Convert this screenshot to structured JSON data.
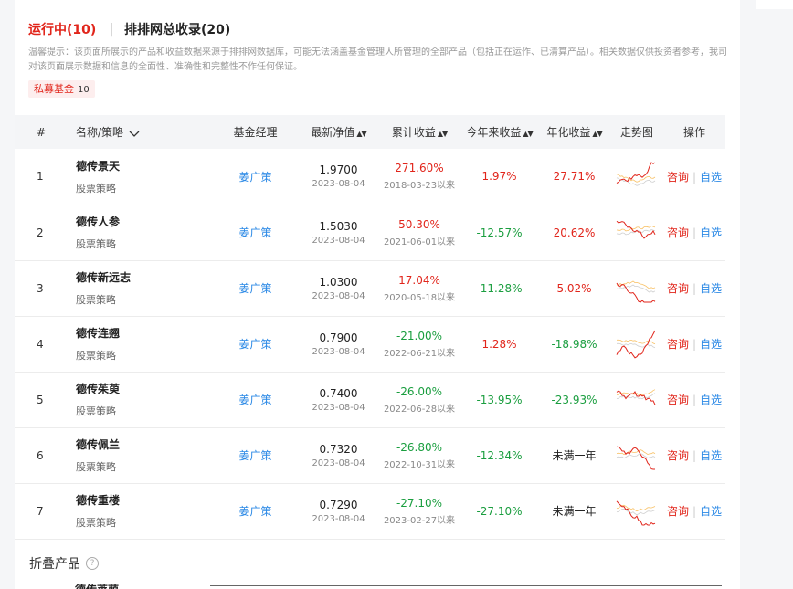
{
  "tabs": {
    "running": "运行中(10)",
    "separator": "|",
    "recorded": "排排网总收录(20)"
  },
  "notice": "温馨提示：该页面所展示的产品和收益数据来源于排排网数据库，可能无法涵盖基金管理人所管理的全部产品（包括正在运作、已清算产品）。相关数据仅供投资者参考，我司对该页面展示数据和信息的全面性、准确性和完整性不作任何保证。",
  "tag": {
    "label": "私募基金",
    "count": "10"
  },
  "table": {
    "headers": {
      "index": "#",
      "name": "名称/策略",
      "manager": "基金经理",
      "nav": "最新净值",
      "cum": "累计收益",
      "ytd": "今年来收益",
      "annual": "年化收益",
      "trend": "走势图",
      "ops": "操作"
    },
    "rows": [
      {
        "idx": "1",
        "name": "德传景天",
        "strategy": "股票策略",
        "manager": "姜广策",
        "nav": "1.9700",
        "nav_date": "2023-08-04",
        "cum": "271.60%",
        "cum_since": "2018-03-23以来",
        "ytd": "1.97%",
        "annual": "27.71%",
        "consult": "咨询",
        "fav": "自选"
      },
      {
        "idx": "2",
        "name": "德传人参",
        "strategy": "股票策略",
        "manager": "姜广策",
        "nav": "1.5030",
        "nav_date": "2023-08-04",
        "cum": "50.30%",
        "cum_since": "2021-06-01以来",
        "ytd": "-12.57%",
        "annual": "20.62%",
        "consult": "咨询",
        "fav": "自选"
      },
      {
        "idx": "3",
        "name": "德传新远志",
        "strategy": "股票策略",
        "manager": "姜广策",
        "nav": "1.0300",
        "nav_date": "2023-08-04",
        "cum": "17.04%",
        "cum_since": "2020-05-18以来",
        "ytd": "-11.28%",
        "annual": "5.02%",
        "consult": "咨询",
        "fav": "自选"
      },
      {
        "idx": "4",
        "name": "德传连翘",
        "strategy": "股票策略",
        "manager": "姜广策",
        "nav": "0.7900",
        "nav_date": "2023-08-04",
        "cum": "-21.00%",
        "cum_since": "2022-06-21以来",
        "ytd": "1.28%",
        "annual": "-18.98%",
        "consult": "咨询",
        "fav": "自选"
      },
      {
        "idx": "5",
        "name": "德传茱萸",
        "strategy": "股票策略",
        "manager": "姜广策",
        "nav": "0.7400",
        "nav_date": "2023-08-04",
        "cum": "-26.00%",
        "cum_since": "2022-06-28以来",
        "ytd": "-13.95%",
        "annual": "-23.93%",
        "consult": "咨询",
        "fav": "自选"
      },
      {
        "idx": "6",
        "name": "德传佩兰",
        "strategy": "股票策略",
        "manager": "姜广策",
        "nav": "0.7320",
        "nav_date": "2023-08-04",
        "cum": "-26.80%",
        "cum_since": "2022-10-31以来",
        "ytd": "-12.34%",
        "annual": "未满一年",
        "consult": "咨询",
        "fav": "自选"
      },
      {
        "idx": "7",
        "name": "德传重楼",
        "strategy": "股票策略",
        "manager": "姜广策",
        "nav": "0.7290",
        "nav_date": "2023-08-04",
        "cum": "-27.10%",
        "cum_since": "2023-02-27以来",
        "ytd": "-27.10%",
        "annual": "未满一年",
        "consult": "咨询",
        "fav": "自选"
      }
    ]
  },
  "folded": {
    "label": "折叠产品",
    "help_icon": "question-circle-icon",
    "next_name_partial": "德传莱菔"
  },
  "colors": {
    "positive": "#e1251b",
    "negative": "#1a9e3f",
    "link": "#2d8ae6",
    "spark_main": "#e1251b",
    "spark_ref": "#f5a623"
  }
}
